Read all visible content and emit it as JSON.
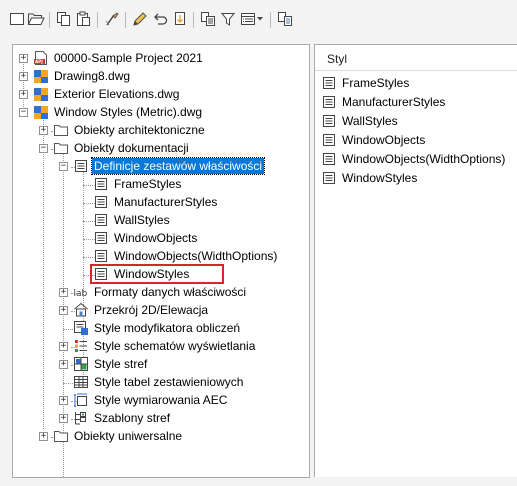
{
  "toolbar": {
    "buttons": [
      {
        "name": "new-icon"
      },
      {
        "name": "open-icon"
      },
      {
        "name": "copy-icon"
      },
      {
        "name": "paste-icon"
      },
      {
        "name": "purge-icon"
      },
      {
        "name": "edit-icon"
      },
      {
        "name": "undo-icon"
      },
      {
        "name": "import-icon"
      },
      {
        "name": "copy-styles-icon"
      },
      {
        "name": "filter-icon"
      },
      {
        "name": "view-mode-icon"
      },
      {
        "name": "view-dropdown-icon"
      },
      {
        "name": "sync-icon"
      }
    ]
  },
  "tree": {
    "items": [
      {
        "label": "00000-Sample Project 2021",
        "icon": "project-icon"
      },
      {
        "label": "Drawing8.dwg",
        "icon": "drawing-icon"
      },
      {
        "label": "Exterior Elevations.dwg",
        "icon": "drawing-icon"
      },
      {
        "label": "Window Styles (Metric).dwg",
        "icon": "drawing-icon"
      },
      {
        "label": "Obiekty architektoniczne",
        "icon": "folder-icon"
      },
      {
        "label": "Obiekty dokumentacji",
        "icon": "folder-icon"
      },
      {
        "label": "Definicje zestawów właściwości",
        "icon": "property-set-icon"
      },
      {
        "label": "FrameStyles",
        "icon": "property-set-icon"
      },
      {
        "label": "ManufacturerStyles",
        "icon": "property-set-icon"
      },
      {
        "label": "WallStyles",
        "icon": "property-set-icon"
      },
      {
        "label": "WindowObjects",
        "icon": "property-set-icon"
      },
      {
        "label": "WindowObjects(WidthOptions)",
        "icon": "property-set-icon"
      },
      {
        "label": "WindowStyles",
        "icon": "property-set-icon"
      },
      {
        "label": "Formaty danych właściwości",
        "icon": "data-format-icon",
        "icon_text": "lab"
      },
      {
        "label": "Przekrój 2D/Elewacja",
        "icon": "section-elevation-icon"
      },
      {
        "label": "Style modyfikatora obliczeń",
        "icon": "calculation-modifier-icon"
      },
      {
        "label": "Style schematów wyświetlania",
        "icon": "display-theme-icon"
      },
      {
        "label": "Style stref",
        "icon": "zone-style-icon"
      },
      {
        "label": "Style tabel zestawieniowych",
        "icon": "schedule-table-icon"
      },
      {
        "label": "Style wymiarowania AEC",
        "icon": "aec-dimension-icon"
      },
      {
        "label": "Szablony stref",
        "icon": "zone-template-icon"
      },
      {
        "label": "Obiekty uniwersalne",
        "icon": "folder-icon"
      }
    ],
    "selected": "Definicje zestawów właściwości",
    "highlighted": "WindowStyles"
  },
  "list": {
    "header": "Styl",
    "items": [
      "FrameStyles",
      "ManufacturerStyles",
      "WallStyles",
      "WindowObjects",
      "WindowObjects(WidthOptions)",
      "WindowStyles"
    ]
  },
  "colors": {
    "selection": "#0b78d7",
    "highlight_border": "#d4262b"
  }
}
